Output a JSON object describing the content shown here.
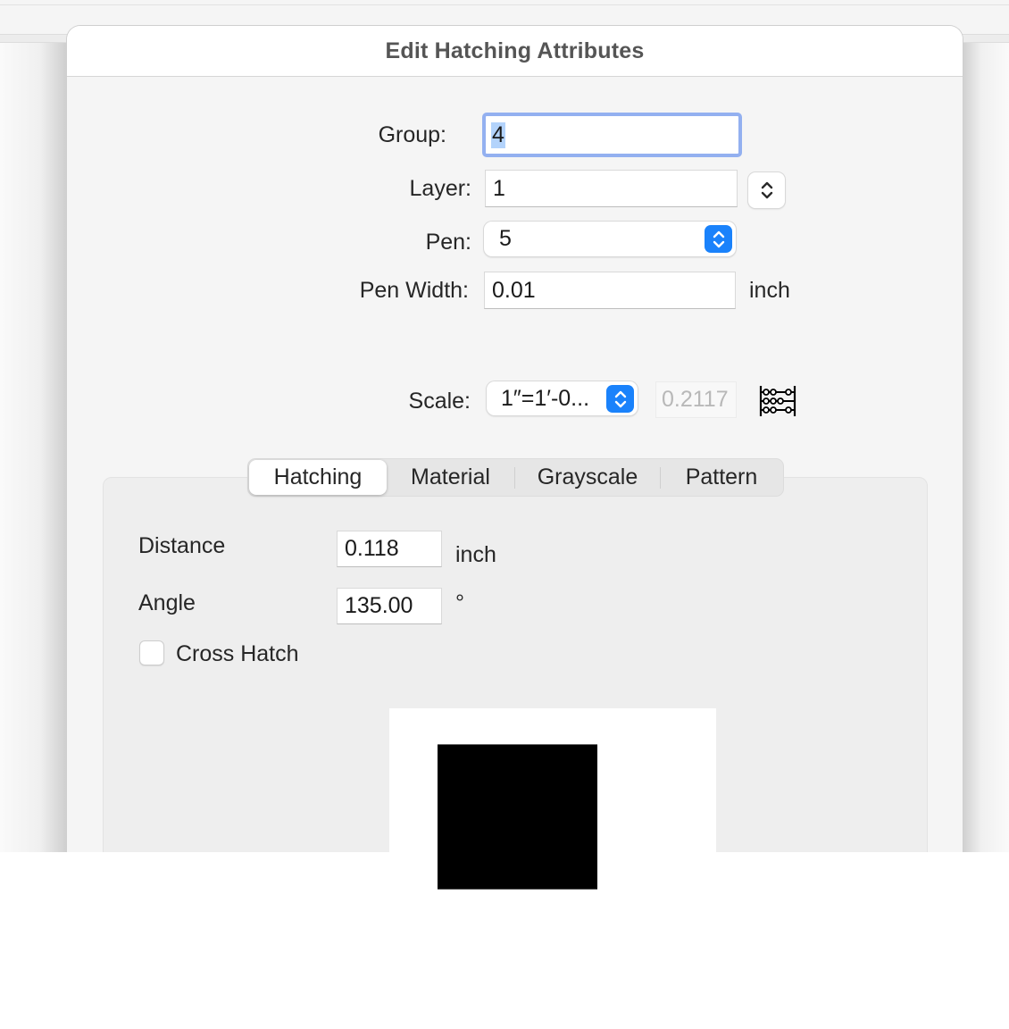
{
  "dialog": {
    "title": "Edit Hatching Attributes"
  },
  "fields": {
    "group": {
      "label": "Group:",
      "value": "4"
    },
    "layer": {
      "label": "Layer:",
      "value": "1"
    },
    "pen": {
      "label": "Pen:",
      "value": "5"
    },
    "pen_width": {
      "label": "Pen Width:",
      "value": "0.01",
      "unit": "inch"
    },
    "scale": {
      "label": "Scale:",
      "value": "1″=1′-0...",
      "factor": "0.2117",
      "icon": "abacus-icon"
    }
  },
  "tabs": [
    {
      "label": "Hatching",
      "active": true
    },
    {
      "label": "Material",
      "active": false
    },
    {
      "label": "Grayscale",
      "active": false
    },
    {
      "label": "Pattern",
      "active": false
    }
  ],
  "hatching": {
    "distance": {
      "label": "Distance",
      "value": "0.118",
      "unit": "inch"
    },
    "angle": {
      "label": "Angle",
      "value": "135.00",
      "unit": "°"
    },
    "cross_hatch": {
      "label": "Cross Hatch",
      "checked": false
    }
  },
  "colors": {
    "accent": "#1a82fb",
    "focus_ring": "#93b0f0",
    "selection": "#b3d3fb",
    "preview_fill": "#000000"
  }
}
